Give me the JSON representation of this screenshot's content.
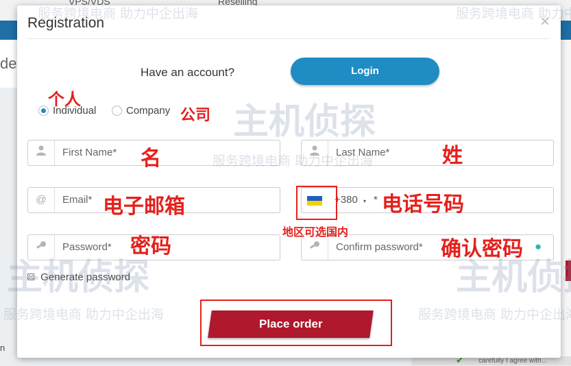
{
  "background": {
    "nav_items": [
      "VPS/VDS",
      "Reselling"
    ],
    "left_text": "de",
    "bottom_left_text": "n",
    "terms_fragment": "carefully I agree with..."
  },
  "modal": {
    "title": "Registration",
    "close_symbol": "×",
    "have_account_text": "Have an account?",
    "login_label": "Login",
    "account_types": [
      {
        "label": "Individual",
        "checked": true
      },
      {
        "label": "Company",
        "checked": false
      }
    ],
    "fields": {
      "first_name": {
        "placeholder": "First Name*",
        "icon": "user-icon"
      },
      "last_name": {
        "placeholder": "Last Name*",
        "icon": "user-icon"
      },
      "email": {
        "placeholder": "Email*",
        "icon": "at-icon"
      },
      "phone": {
        "country_code": "+380",
        "caret": "▾",
        "required_mark": "*",
        "flag": "ukraine-flag"
      },
      "password": {
        "placeholder": "Password*",
        "icon": "key-icon"
      },
      "confirm_password": {
        "placeholder": "Confirm password*",
        "icon": "key-icon"
      }
    },
    "generate_password_label": "Generate password",
    "place_order_label": "Place order"
  },
  "annotations": {
    "individual": "个人",
    "company": "公司",
    "first_name": "名",
    "last_name": "姓",
    "email": "电子邮箱",
    "phone": "电话号码",
    "region": "地区可选国内",
    "password": "密码",
    "confirm_password": "确认密码"
  },
  "watermarks": {
    "service_line": "服务跨境电商 助力中企出海",
    "brand": "主机侦探"
  },
  "colors": {
    "accent_blue": "#1f8cc3",
    "primary_red": "#b0182d",
    "annotation_red": "#e5201c"
  }
}
